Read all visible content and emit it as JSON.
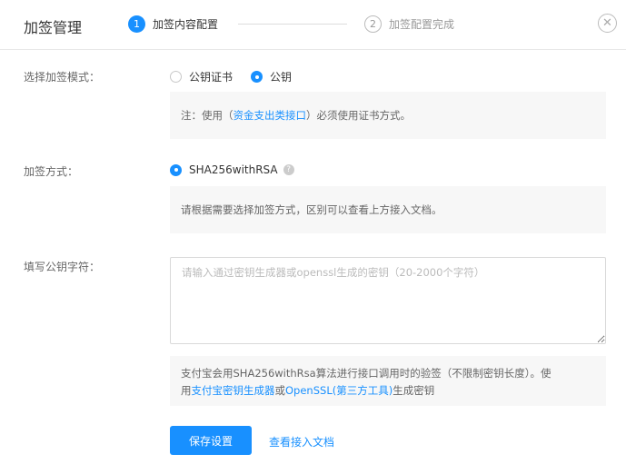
{
  "header": {
    "title": "加签管理",
    "steps": [
      {
        "num": "1",
        "label": "加签内容配置"
      },
      {
        "num": "2",
        "label": "加签配置完成"
      }
    ],
    "close_glyph": "⊗"
  },
  "mode": {
    "label": "选择加签模式：",
    "options": [
      {
        "label": "公钥证书",
        "selected": false
      },
      {
        "label": "公钥",
        "selected": true
      }
    ],
    "note_prefix": "注：使用（",
    "note_link": "资金支出类接口",
    "note_suffix": "）必须使用证书方式。"
  },
  "method": {
    "label": "加签方式：",
    "option": "SHA256withRSA",
    "note": "请根据需要选择加签方式，区别可以查看上方接入文档。"
  },
  "key": {
    "label": "填写公钥字符：",
    "placeholder": "请输入通过密钥生成器或openssl生成的密钥（20-2000个字符）",
    "note_line1": "支付宝会用SHA256withRsa算法进行接口调用时的验签（不限制密钥长度）。使",
    "note_prefix": "用",
    "note_link1": "支付宝密钥生成器",
    "note_mid": "或",
    "note_link2": "OpenSSL(第三方工具)",
    "note_suffix": "生成密钥"
  },
  "actions": {
    "save_label": "保存设置",
    "doc_link": "查看接入文档"
  },
  "colors": {
    "accent": "#1890ff",
    "note_bg": "#f7f7f7"
  }
}
